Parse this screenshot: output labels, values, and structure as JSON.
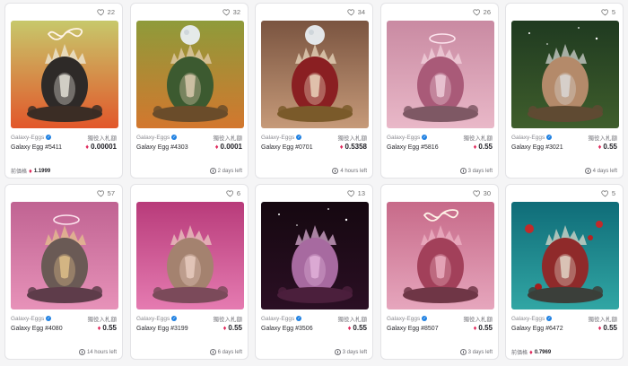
{
  "cards": [
    {
      "likes": "22",
      "collection": "Galaxy-Eggs",
      "price_label": "獨役入札額",
      "name": "Galaxy Egg #5411",
      "price": "0.00001",
      "footer_left_label": "前価格",
      "footer_left_value": "1.1999",
      "time": "",
      "art": {
        "bg1": "#c7c86b",
        "bg2": "#e2572a",
        "egg": "#2e2a28",
        "accent": "#f1efe4",
        "ground": "#3b2d25",
        "sky": "infinity"
      }
    },
    {
      "likes": "32",
      "collection": "Galaxy-Eggs",
      "price_label": "獨役入札額",
      "name": "Galaxy Egg #4303",
      "price": "0.0001",
      "footer_left_label": "",
      "footer_left_value": "",
      "time": "2 days left",
      "art": {
        "bg1": "#8e9b3a",
        "bg2": "#d3772e",
        "egg": "#3c5a30",
        "accent": "#e7d3b8",
        "ground": "#6a4c2a",
        "sky": "moon"
      }
    },
    {
      "likes": "34",
      "collection": "Galaxy-Eggs",
      "price_label": "獨役入札額",
      "name": "Galaxy Egg #0701",
      "price": "0.5358",
      "footer_left_label": "",
      "footer_left_value": "",
      "time": "4 hours left",
      "art": {
        "bg1": "#7a5440",
        "bg2": "#c69a79",
        "egg": "#8a1f22",
        "accent": "#f0e0c6",
        "ground": "#7a5a2a",
        "sky": "moon"
      }
    },
    {
      "likes": "26",
      "collection": "Galaxy-Eggs",
      "price_label": "獨役入札額",
      "name": "Galaxy Egg #5816",
      "price": "0.55",
      "footer_left_label": "",
      "footer_left_value": "",
      "time": "3 days left",
      "art": {
        "bg1": "#c98aa2",
        "bg2": "#e9b8c8",
        "egg": "#a95a78",
        "accent": "#f3d6e0",
        "ground": "#7e5864",
        "sky": "ring"
      }
    },
    {
      "likes": "5",
      "collection": "Galaxy-Eggs",
      "price_label": "獨役入札額",
      "name": "Galaxy Egg #3021",
      "price": "0.55",
      "footer_left_label": "",
      "footer_left_value": "",
      "time": "4 days left",
      "art": {
        "bg1": "#1f3a20",
        "bg2": "#3f5e2c",
        "egg": "#b48a6a",
        "accent": "#dcdcdc",
        "ground": "#5f4a32",
        "sky": "stars"
      }
    },
    {
      "likes": "57",
      "collection": "Galaxy-Eggs",
      "price_label": "獨役入札額",
      "name": "Galaxy Egg #4080",
      "price": "0.55",
      "footer_left_label": "",
      "footer_left_value": "",
      "time": "14 hours left",
      "art": {
        "bg1": "#c06392",
        "bg2": "#e792b9",
        "egg": "#6a5a55",
        "accent": "#e7c78c",
        "ground": "#5e3c4a",
        "sky": "ring"
      }
    },
    {
      "likes": "6",
      "collection": "Galaxy-Eggs",
      "price_label": "獨役入札額",
      "name": "Galaxy Egg #3199",
      "price": "0.55",
      "footer_left_label": "",
      "footer_left_value": "",
      "time": "6 days left",
      "art": {
        "bg1": "#b83b7a",
        "bg2": "#e57bb1",
        "egg": "#a4826f",
        "accent": "#eed2c5",
        "ground": "#7b4a5a",
        "sky": "none"
      }
    },
    {
      "likes": "13",
      "collection": "Galaxy-Eggs",
      "price_label": "獨役入札額",
      "name": "Galaxy Egg #3506",
      "price": "0.55",
      "footer_left_label": "",
      "footer_left_value": "",
      "time": "3 days left",
      "art": {
        "bg1": "#150810",
        "bg2": "#2b0f24",
        "egg": "#a76aa0",
        "accent": "#e5b6de",
        "ground": "#4b1f3c",
        "sky": "stars"
      }
    },
    {
      "likes": "30",
      "collection": "Galaxy-Eggs",
      "price_label": "獨役入札額",
      "name": "Galaxy Egg #8507",
      "price": "0.55",
      "footer_left_label": "",
      "footer_left_value": "",
      "time": "3 days left",
      "art": {
        "bg1": "#c76a89",
        "bg2": "#e6a6bd",
        "egg": "#a2405a",
        "accent": "#f0b6c7",
        "ground": "#6f3646",
        "sky": "infinity"
      }
    },
    {
      "likes": "5",
      "collection": "Galaxy-Eggs",
      "price_label": "獨役入札額",
      "name": "Galaxy Egg #6472",
      "price": "0.55",
      "footer_left_label": "前価格",
      "footer_left_value": "0.7969",
      "time": "",
      "art": {
        "bg1": "#0f6c78",
        "bg2": "#31a6a4",
        "egg": "#8f2a2a",
        "accent": "#e7e0d0",
        "ground": "#3b3f3a",
        "sky": "balloons"
      }
    }
  ]
}
